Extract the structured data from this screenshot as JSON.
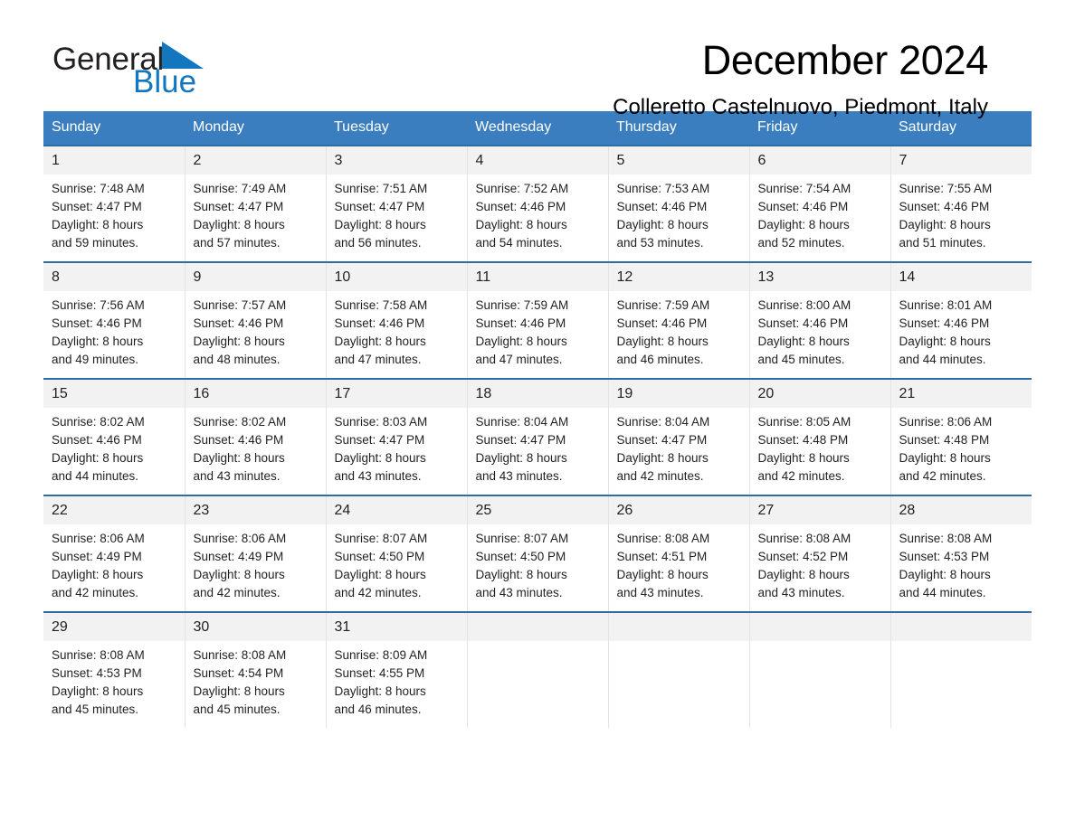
{
  "brand": {
    "name_part1": "General",
    "name_part2": "Blue",
    "mark": "triangle-logo",
    "accent_color": "#1277bf"
  },
  "header": {
    "title": "December 2024",
    "subtitle": "Colleretto Castelnuovo, Piedmont, Italy"
  },
  "calendar": {
    "header_bg": "#3b7ebf",
    "row_divider": "#2e6da4",
    "daynum_bg": "#f2f2f2",
    "weekdays": [
      "Sunday",
      "Monday",
      "Tuesday",
      "Wednesday",
      "Thursday",
      "Friday",
      "Saturday"
    ],
    "weeks": [
      [
        {
          "day": "1",
          "sunrise": "Sunrise: 7:48 AM",
          "sunset": "Sunset: 4:47 PM",
          "daylight1": "Daylight: 8 hours",
          "daylight2": "and 59 minutes."
        },
        {
          "day": "2",
          "sunrise": "Sunrise: 7:49 AM",
          "sunset": "Sunset: 4:47 PM",
          "daylight1": "Daylight: 8 hours",
          "daylight2": "and 57 minutes."
        },
        {
          "day": "3",
          "sunrise": "Sunrise: 7:51 AM",
          "sunset": "Sunset: 4:47 PM",
          "daylight1": "Daylight: 8 hours",
          "daylight2": "and 56 minutes."
        },
        {
          "day": "4",
          "sunrise": "Sunrise: 7:52 AM",
          "sunset": "Sunset: 4:46 PM",
          "daylight1": "Daylight: 8 hours",
          "daylight2": "and 54 minutes."
        },
        {
          "day": "5",
          "sunrise": "Sunrise: 7:53 AM",
          "sunset": "Sunset: 4:46 PM",
          "daylight1": "Daylight: 8 hours",
          "daylight2": "and 53 minutes."
        },
        {
          "day": "6",
          "sunrise": "Sunrise: 7:54 AM",
          "sunset": "Sunset: 4:46 PM",
          "daylight1": "Daylight: 8 hours",
          "daylight2": "and 52 minutes."
        },
        {
          "day": "7",
          "sunrise": "Sunrise: 7:55 AM",
          "sunset": "Sunset: 4:46 PM",
          "daylight1": "Daylight: 8 hours",
          "daylight2": "and 51 minutes."
        }
      ],
      [
        {
          "day": "8",
          "sunrise": "Sunrise: 7:56 AM",
          "sunset": "Sunset: 4:46 PM",
          "daylight1": "Daylight: 8 hours",
          "daylight2": "and 49 minutes."
        },
        {
          "day": "9",
          "sunrise": "Sunrise: 7:57 AM",
          "sunset": "Sunset: 4:46 PM",
          "daylight1": "Daylight: 8 hours",
          "daylight2": "and 48 minutes."
        },
        {
          "day": "10",
          "sunrise": "Sunrise: 7:58 AM",
          "sunset": "Sunset: 4:46 PM",
          "daylight1": "Daylight: 8 hours",
          "daylight2": "and 47 minutes."
        },
        {
          "day": "11",
          "sunrise": "Sunrise: 7:59 AM",
          "sunset": "Sunset: 4:46 PM",
          "daylight1": "Daylight: 8 hours",
          "daylight2": "and 47 minutes."
        },
        {
          "day": "12",
          "sunrise": "Sunrise: 7:59 AM",
          "sunset": "Sunset: 4:46 PM",
          "daylight1": "Daylight: 8 hours",
          "daylight2": "and 46 minutes."
        },
        {
          "day": "13",
          "sunrise": "Sunrise: 8:00 AM",
          "sunset": "Sunset: 4:46 PM",
          "daylight1": "Daylight: 8 hours",
          "daylight2": "and 45 minutes."
        },
        {
          "day": "14",
          "sunrise": "Sunrise: 8:01 AM",
          "sunset": "Sunset: 4:46 PM",
          "daylight1": "Daylight: 8 hours",
          "daylight2": "and 44 minutes."
        }
      ],
      [
        {
          "day": "15",
          "sunrise": "Sunrise: 8:02 AM",
          "sunset": "Sunset: 4:46 PM",
          "daylight1": "Daylight: 8 hours",
          "daylight2": "and 44 minutes."
        },
        {
          "day": "16",
          "sunrise": "Sunrise: 8:02 AM",
          "sunset": "Sunset: 4:46 PM",
          "daylight1": "Daylight: 8 hours",
          "daylight2": "and 43 minutes."
        },
        {
          "day": "17",
          "sunrise": "Sunrise: 8:03 AM",
          "sunset": "Sunset: 4:47 PM",
          "daylight1": "Daylight: 8 hours",
          "daylight2": "and 43 minutes."
        },
        {
          "day": "18",
          "sunrise": "Sunrise: 8:04 AM",
          "sunset": "Sunset: 4:47 PM",
          "daylight1": "Daylight: 8 hours",
          "daylight2": "and 43 minutes."
        },
        {
          "day": "19",
          "sunrise": "Sunrise: 8:04 AM",
          "sunset": "Sunset: 4:47 PM",
          "daylight1": "Daylight: 8 hours",
          "daylight2": "and 42 minutes."
        },
        {
          "day": "20",
          "sunrise": "Sunrise: 8:05 AM",
          "sunset": "Sunset: 4:48 PM",
          "daylight1": "Daylight: 8 hours",
          "daylight2": "and 42 minutes."
        },
        {
          "day": "21",
          "sunrise": "Sunrise: 8:06 AM",
          "sunset": "Sunset: 4:48 PM",
          "daylight1": "Daylight: 8 hours",
          "daylight2": "and 42 minutes."
        }
      ],
      [
        {
          "day": "22",
          "sunrise": "Sunrise: 8:06 AM",
          "sunset": "Sunset: 4:49 PM",
          "daylight1": "Daylight: 8 hours",
          "daylight2": "and 42 minutes."
        },
        {
          "day": "23",
          "sunrise": "Sunrise: 8:06 AM",
          "sunset": "Sunset: 4:49 PM",
          "daylight1": "Daylight: 8 hours",
          "daylight2": "and 42 minutes."
        },
        {
          "day": "24",
          "sunrise": "Sunrise: 8:07 AM",
          "sunset": "Sunset: 4:50 PM",
          "daylight1": "Daylight: 8 hours",
          "daylight2": "and 42 minutes."
        },
        {
          "day": "25",
          "sunrise": "Sunrise: 8:07 AM",
          "sunset": "Sunset: 4:50 PM",
          "daylight1": "Daylight: 8 hours",
          "daylight2": "and 43 minutes."
        },
        {
          "day": "26",
          "sunrise": "Sunrise: 8:08 AM",
          "sunset": "Sunset: 4:51 PM",
          "daylight1": "Daylight: 8 hours",
          "daylight2": "and 43 minutes."
        },
        {
          "day": "27",
          "sunrise": "Sunrise: 8:08 AM",
          "sunset": "Sunset: 4:52 PM",
          "daylight1": "Daylight: 8 hours",
          "daylight2": "and 43 minutes."
        },
        {
          "day": "28",
          "sunrise": "Sunrise: 8:08 AM",
          "sunset": "Sunset: 4:53 PM",
          "daylight1": "Daylight: 8 hours",
          "daylight2": "and 44 minutes."
        }
      ],
      [
        {
          "day": "29",
          "sunrise": "Sunrise: 8:08 AM",
          "sunset": "Sunset: 4:53 PM",
          "daylight1": "Daylight: 8 hours",
          "daylight2": "and 45 minutes."
        },
        {
          "day": "30",
          "sunrise": "Sunrise: 8:08 AM",
          "sunset": "Sunset: 4:54 PM",
          "daylight1": "Daylight: 8 hours",
          "daylight2": "and 45 minutes."
        },
        {
          "day": "31",
          "sunrise": "Sunrise: 8:09 AM",
          "sunset": "Sunset: 4:55 PM",
          "daylight1": "Daylight: 8 hours",
          "daylight2": "and 46 minutes."
        },
        {
          "day": "",
          "sunrise": "",
          "sunset": "",
          "daylight1": "",
          "daylight2": ""
        },
        {
          "day": "",
          "sunrise": "",
          "sunset": "",
          "daylight1": "",
          "daylight2": ""
        },
        {
          "day": "",
          "sunrise": "",
          "sunset": "",
          "daylight1": "",
          "daylight2": ""
        },
        {
          "day": "",
          "sunrise": "",
          "sunset": "",
          "daylight1": "",
          "daylight2": ""
        }
      ]
    ]
  }
}
